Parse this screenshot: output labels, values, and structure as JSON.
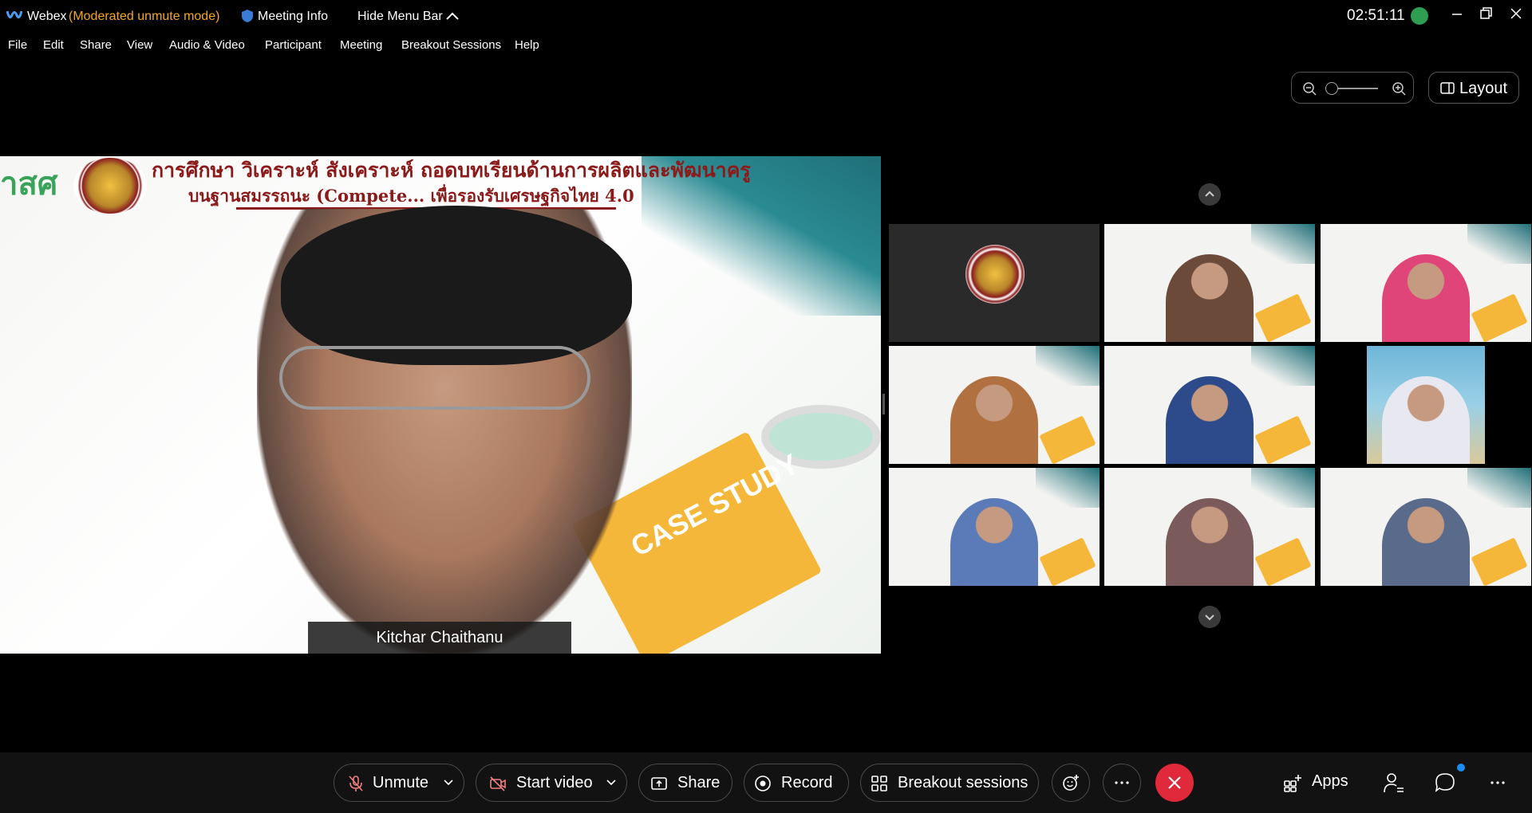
{
  "titlebar": {
    "app_name": "Webex",
    "mode": "(Moderated unmute mode)",
    "meeting_info": "Meeting Info",
    "hide_menu_bar": "Hide Menu Bar",
    "clock": "02:51:11"
  },
  "menu": [
    "File",
    "Edit",
    "Share",
    "View",
    "Audio & Video",
    "Participant",
    "Meeting",
    "Breakout Sessions",
    "Help"
  ],
  "view_controls": {
    "layout_label": "Layout"
  },
  "stage": {
    "speaker_name": "Kitchar Chaithanu",
    "slide_logo_text": "าสศ",
    "slide_title_line1": "การศึกษา วิเคราะห์ สังเคราะห์ ถอดบทเรียนด้านการผลิตและพัฒนาครู",
    "slide_title_line2": "บนฐานสมรรถนะ (Compete... เพื่อรองรับเศรษฐกิจไทย 4.0",
    "slide_book_text": "CASE STUDY"
  },
  "gallery": {
    "tiles": [
      {
        "kind": "seal"
      },
      {
        "kind": "video",
        "tone": "#6b4a3a"
      },
      {
        "kind": "video",
        "tone": "#e0457a"
      },
      {
        "kind": "video",
        "tone": "#b07040"
      },
      {
        "kind": "video",
        "tone": "#2d4a8a"
      },
      {
        "kind": "beach",
        "tone": "#e8e8f0"
      },
      {
        "kind": "video",
        "tone": "#5a7ab8"
      },
      {
        "kind": "video",
        "tone": "#7a5a5a"
      },
      {
        "kind": "video",
        "tone": "#5a6a8a"
      }
    ]
  },
  "controls": {
    "unmute": "Unmute",
    "start_video": "Start video",
    "share": "Share",
    "record": "Record",
    "breakout": "Breakout sessions",
    "apps": "Apps"
  },
  "colors": {
    "mode_text": "#f5a623",
    "end_call": "#e0293a",
    "accent_dot": "#1c8cf0"
  }
}
